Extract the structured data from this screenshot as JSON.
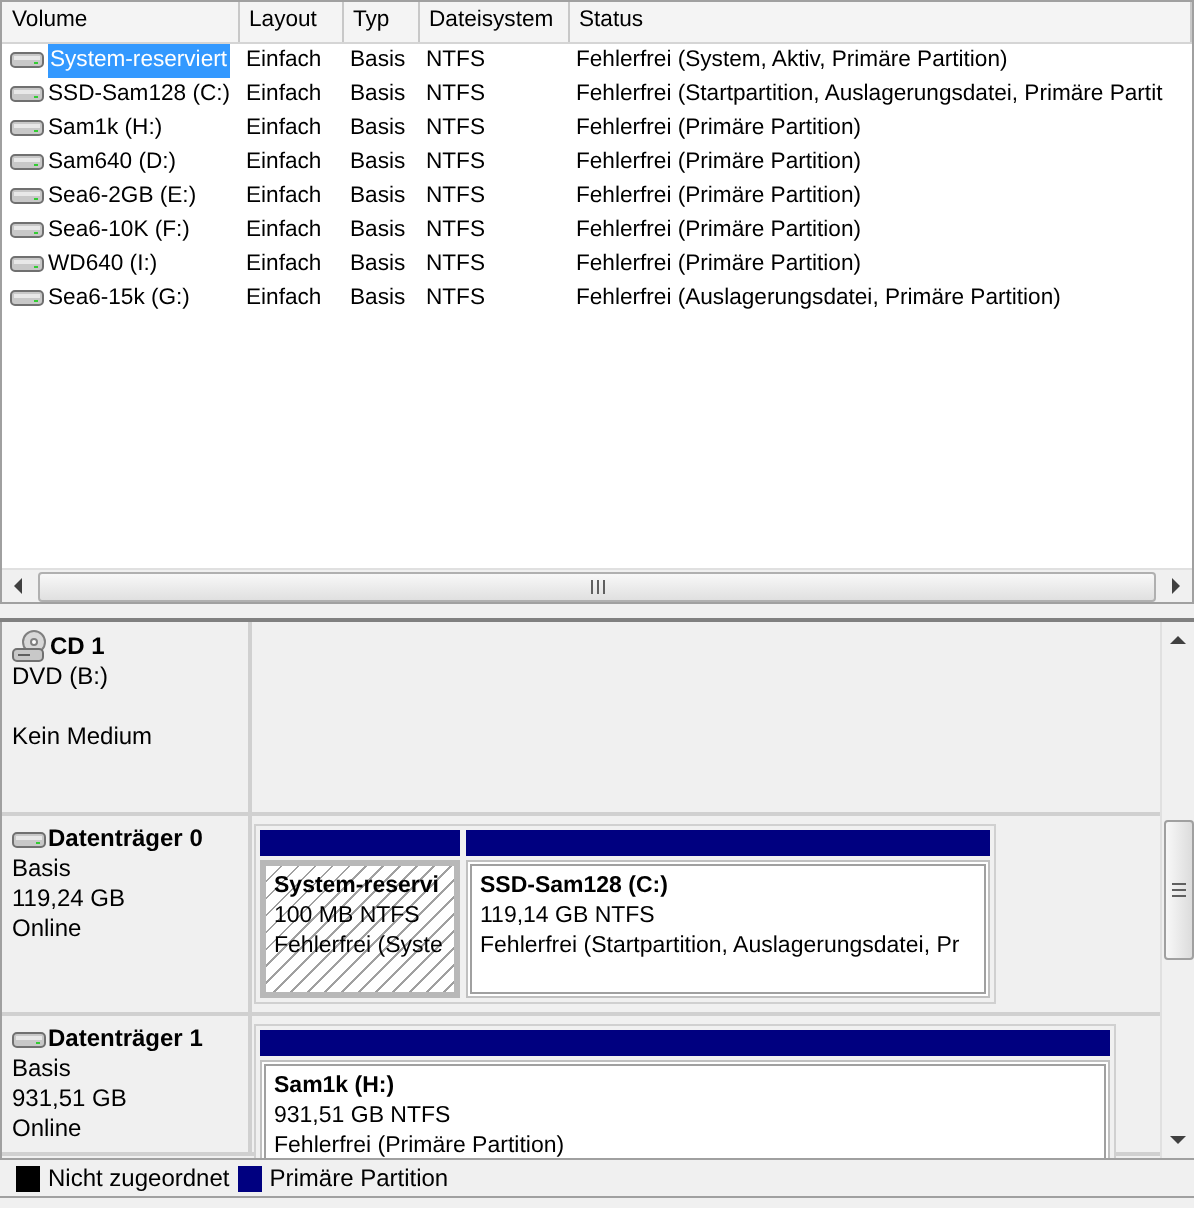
{
  "volume_list": {
    "columns": [
      "Volume",
      "Layout",
      "Typ",
      "Dateisystem",
      "Status"
    ],
    "rows": [
      {
        "volume": "System-reserviert",
        "layout": "Einfach",
        "type": "Basis",
        "filesystem": "NTFS",
        "status": "Fehlerfrei (System, Aktiv, Primäre Partition)",
        "selected": true
      },
      {
        "volume": "SSD-Sam128 (C:)",
        "layout": "Einfach",
        "type": "Basis",
        "filesystem": "NTFS",
        "status": "Fehlerfrei (Startpartition, Auslagerungsdatei, Primäre Partit",
        "selected": false
      },
      {
        "volume": "Sam1k (H:)",
        "layout": "Einfach",
        "type": "Basis",
        "filesystem": "NTFS",
        "status": "Fehlerfrei (Primäre Partition)",
        "selected": false
      },
      {
        "volume": "Sam640 (D:)",
        "layout": "Einfach",
        "type": "Basis",
        "filesystem": "NTFS",
        "status": "Fehlerfrei (Primäre Partition)",
        "selected": false
      },
      {
        "volume": "Sea6-2GB (E:)",
        "layout": "Einfach",
        "type": "Basis",
        "filesystem": "NTFS",
        "status": "Fehlerfrei (Primäre Partition)",
        "selected": false
      },
      {
        "volume": "Sea6-10K (F:)",
        "layout": "Einfach",
        "type": "Basis",
        "filesystem": "NTFS",
        "status": "Fehlerfrei (Primäre Partition)",
        "selected": false
      },
      {
        "volume": "WD640 (I:)",
        "layout": "Einfach",
        "type": "Basis",
        "filesystem": "NTFS",
        "status": "Fehlerfrei (Primäre Partition)",
        "selected": false
      },
      {
        "volume": "Sea6-15k (G:)",
        "layout": "Einfach",
        "type": "Basis",
        "filesystem": "NTFS",
        "status": "Fehlerfrei (Auslagerungsdatei, Primäre Partition)",
        "selected": false
      }
    ]
  },
  "disks": [
    {
      "kind": "cdrom",
      "name": "CD 1",
      "drive": "DVD (B:)",
      "media": "Kein Medium"
    },
    {
      "kind": "disk",
      "name": "Datenträger 0",
      "type": "Basis",
      "size": "119,24 GB",
      "status": "Online",
      "partitions": [
        {
          "name": "System-reservi",
          "size": "100 MB NTFS",
          "status": "Fehlerfrei (Syste",
          "selected": true
        },
        {
          "name": "SSD-Sam128  (C:)",
          "size": "119,14 GB NTFS",
          "status": "Fehlerfrei (Startpartition, Auslagerungsdatei, Pr",
          "selected": false
        }
      ]
    },
    {
      "kind": "disk",
      "name": "Datenträger 1",
      "type": "Basis",
      "size": "931,51 GB",
      "status": "Online",
      "partitions": [
        {
          "name": "Sam1k  (H:)",
          "size": "931,51 GB NTFS",
          "status": "Fehlerfrei (Primäre Partition)",
          "selected": false
        }
      ]
    }
  ],
  "legend": [
    {
      "label": "Nicht zugeordnet",
      "color": "#000000"
    },
    {
      "label": "Primäre Partition",
      "color": "#000080"
    }
  ]
}
